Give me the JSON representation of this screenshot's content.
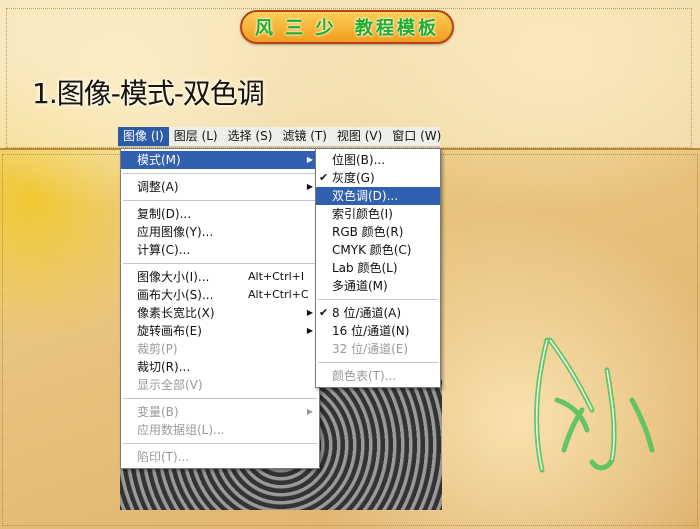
{
  "banner": {
    "text": "风 三 少  教程模板"
  },
  "heading": {
    "title": "1.图像-模式-双色调"
  },
  "menubar": {
    "items": [
      "图像 (I)",
      "图层 (L)",
      "选择 (S)",
      "滤镜 (T)",
      "视图 (V)",
      "窗口 (W)"
    ],
    "active_index": 0
  },
  "image_menu": {
    "items": [
      {
        "label": "模式(M)",
        "shortcut": "",
        "submenu": true,
        "disabled": false,
        "highlighted": true
      },
      {
        "sep": true
      },
      {
        "label": "调整(A)",
        "shortcut": "",
        "submenu": true,
        "disabled": false
      },
      {
        "sep": true
      },
      {
        "label": "复制(D)...",
        "shortcut": "",
        "submenu": false,
        "disabled": false
      },
      {
        "label": "应用图像(Y)...",
        "shortcut": "",
        "submenu": false,
        "disabled": false
      },
      {
        "label": "计算(C)...",
        "shortcut": "",
        "submenu": false,
        "disabled": false
      },
      {
        "sep": true
      },
      {
        "label": "图像大小(I)...",
        "shortcut": "Alt+Ctrl+I",
        "submenu": false,
        "disabled": false
      },
      {
        "label": "画布大小(S)...",
        "shortcut": "Alt+Ctrl+C",
        "submenu": false,
        "disabled": false
      },
      {
        "label": "像素长宽比(X)",
        "shortcut": "",
        "submenu": true,
        "disabled": false
      },
      {
        "label": "旋转画布(E)",
        "shortcut": "",
        "submenu": true,
        "disabled": false
      },
      {
        "label": "裁剪(P)",
        "shortcut": "",
        "submenu": false,
        "disabled": true
      },
      {
        "label": "裁切(R)...",
        "shortcut": "",
        "submenu": false,
        "disabled": false
      },
      {
        "label": "显示全部(V)",
        "shortcut": "",
        "submenu": false,
        "disabled": true
      },
      {
        "sep": true
      },
      {
        "label": "变量(B)",
        "shortcut": "",
        "submenu": true,
        "disabled": true
      },
      {
        "label": "应用数据组(L)...",
        "shortcut": "",
        "submenu": false,
        "disabled": true
      },
      {
        "sep": true
      },
      {
        "label": "陷印(T)...",
        "shortcut": "",
        "submenu": false,
        "disabled": true
      }
    ]
  },
  "mode_submenu": {
    "items": [
      {
        "label": "位图(B)...",
        "checked": false,
        "disabled": false
      },
      {
        "label": "灰度(G)",
        "checked": true,
        "disabled": false
      },
      {
        "label": "双色调(D)...",
        "checked": false,
        "disabled": false,
        "highlighted": true
      },
      {
        "label": "索引颜色(I)",
        "checked": false,
        "disabled": false
      },
      {
        "label": "RGB 颜色(R)",
        "checked": false,
        "disabled": false
      },
      {
        "label": "CMYK 颜色(C)",
        "checked": false,
        "disabled": false
      },
      {
        "label": "Lab 颜色(L)",
        "checked": false,
        "disabled": false
      },
      {
        "label": "多通道(M)",
        "checked": false,
        "disabled": false
      },
      {
        "sep": true
      },
      {
        "label": "8 位/通道(A)",
        "checked": true,
        "disabled": false
      },
      {
        "label": "16 位/通道(N)",
        "checked": false,
        "disabled": false
      },
      {
        "label": "32 位/通道(E)",
        "checked": false,
        "disabled": true
      },
      {
        "sep": true
      },
      {
        "label": "颜色表(T)...",
        "checked": false,
        "disabled": true
      }
    ]
  },
  "icons": {
    "submenu_arrow": "triangle-right-icon",
    "check": "checkmark-icon"
  },
  "colors": {
    "menu_highlight": "#3160b0",
    "banner_text": "#1fae2a",
    "deco_stroke": "#4cc25a"
  }
}
